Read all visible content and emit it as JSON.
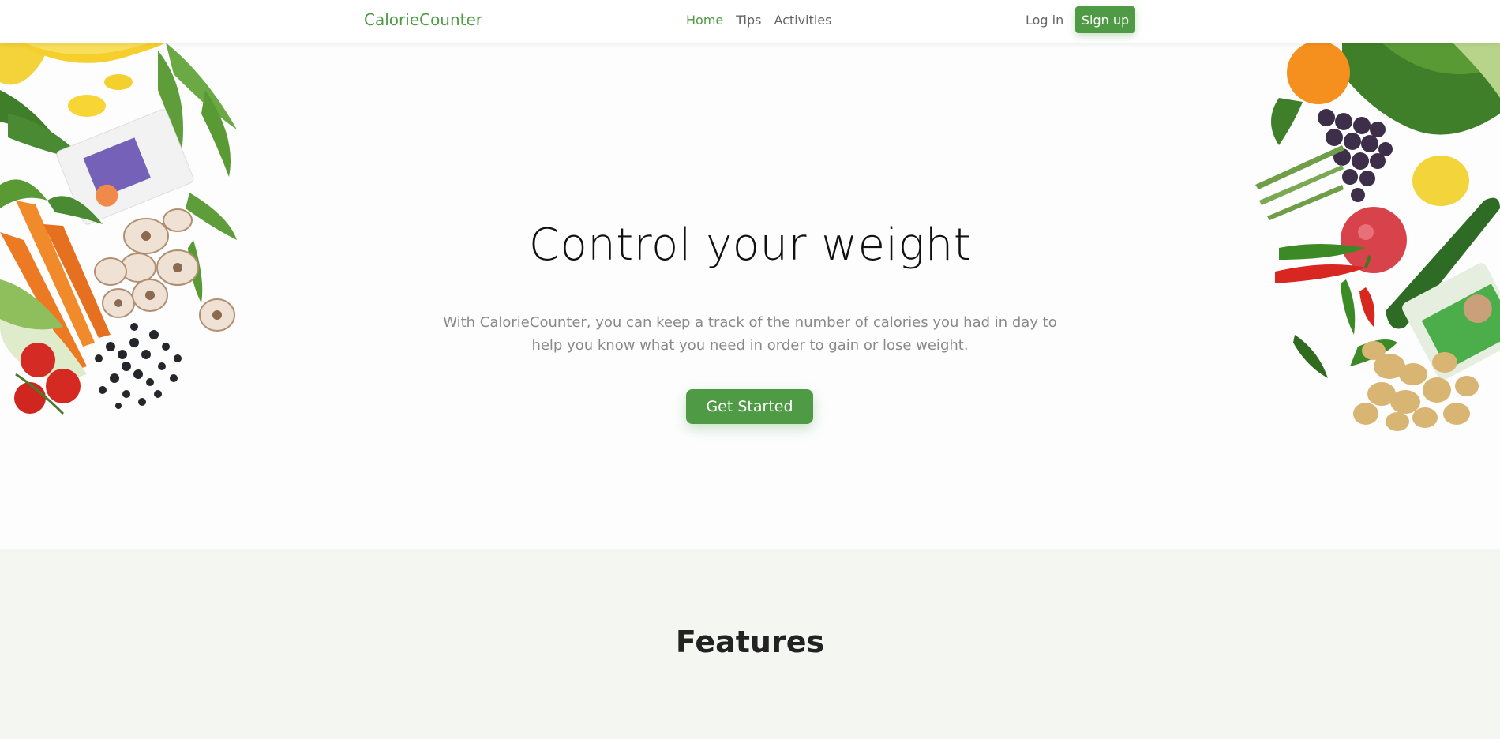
{
  "nav": {
    "brand": "CalorieCounter",
    "links": [
      {
        "label": "Home",
        "active": true
      },
      {
        "label": "Tips",
        "active": false
      },
      {
        "label": "Activities",
        "active": false
      }
    ],
    "login_label": "Log in",
    "signup_label": "Sign up"
  },
  "hero": {
    "title": "Control your weight",
    "description": "With CalorieCounter, you can keep a track of the number of calories you had in day to help you know what you need in order to gain or lose weight.",
    "cta_label": "Get Started"
  },
  "features": {
    "title": "Features"
  },
  "colors": {
    "accent": "#4e9a45",
    "features_bg": "#f4f6f1"
  }
}
